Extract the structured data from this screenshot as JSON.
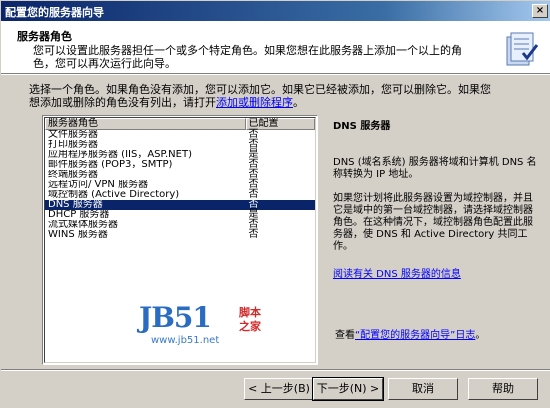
{
  "window": {
    "title": "配置您的服务器向导",
    "close": "×"
  },
  "header": {
    "title": "服务器角色",
    "desc_line1": "您可以设置此服务器担任一个或多个特定角色。如果您想在此服务器上添加一个以上的角",
    "desc_line2": "色，您可以再次运行此向导。"
  },
  "intro": {
    "text1": "选择一个角色。如果角色没有添加，您可以添加它。如果它已经被添加，您可以删除它。如果您",
    "text2": "想添加或删除的角色没有列出，请打开",
    "link": "添加或删除程序",
    "end": "。"
  },
  "list": {
    "col_role": "服务器角色",
    "col_config": "已配置",
    "rows": [
      {
        "role": "文件服务器",
        "configured": "否"
      },
      {
        "role": "打印服务器",
        "configured": "否"
      },
      {
        "role": "应用程序服务器 (IIS，ASP.NET)",
        "configured": "是"
      },
      {
        "role": "邮件服务器 (POP3，SMTP)",
        "configured": "否"
      },
      {
        "role": "终端服务器",
        "configured": "否"
      },
      {
        "role": "远程访问/ VPN 服务器",
        "configured": "否"
      },
      {
        "role": "域控制器 (Active Directory)",
        "configured": "否"
      },
      {
        "role": "DNS 服务器",
        "configured": "否",
        "selected": true
      },
      {
        "role": "DHCP 服务器",
        "configured": "是"
      },
      {
        "role": "流式媒体服务器",
        "configured": "否"
      },
      {
        "role": "WINS 服务器",
        "configured": "否"
      }
    ]
  },
  "details": {
    "title": "DNS 服务器",
    "p1": "DNS (域名系统) 服务器将域和计算机 DNS 名称转换为 IP 地址。",
    "p2": "如果您计划将此服务器设置为域控制器，并且它是域中的第一台域控制器，请选择域控制器角色。在这种情况下，域控制器角色配置此服务器，使 DNS 和 Active Directory 共同工作。",
    "link": "阅读有关 DNS 服务器的信息"
  },
  "watermark": {
    "logo": "JB51",
    "cn1": "脚本",
    "cn2": "之家",
    "url": "www.jb51.net"
  },
  "log": {
    "prefix": "查看",
    "link": "“配置您的服务器向导”日志",
    "suffix": "。"
  },
  "buttons": {
    "back": "< 上一步(B)",
    "next": "下一步(N) >",
    "cancel": "取消",
    "help": "帮助"
  }
}
